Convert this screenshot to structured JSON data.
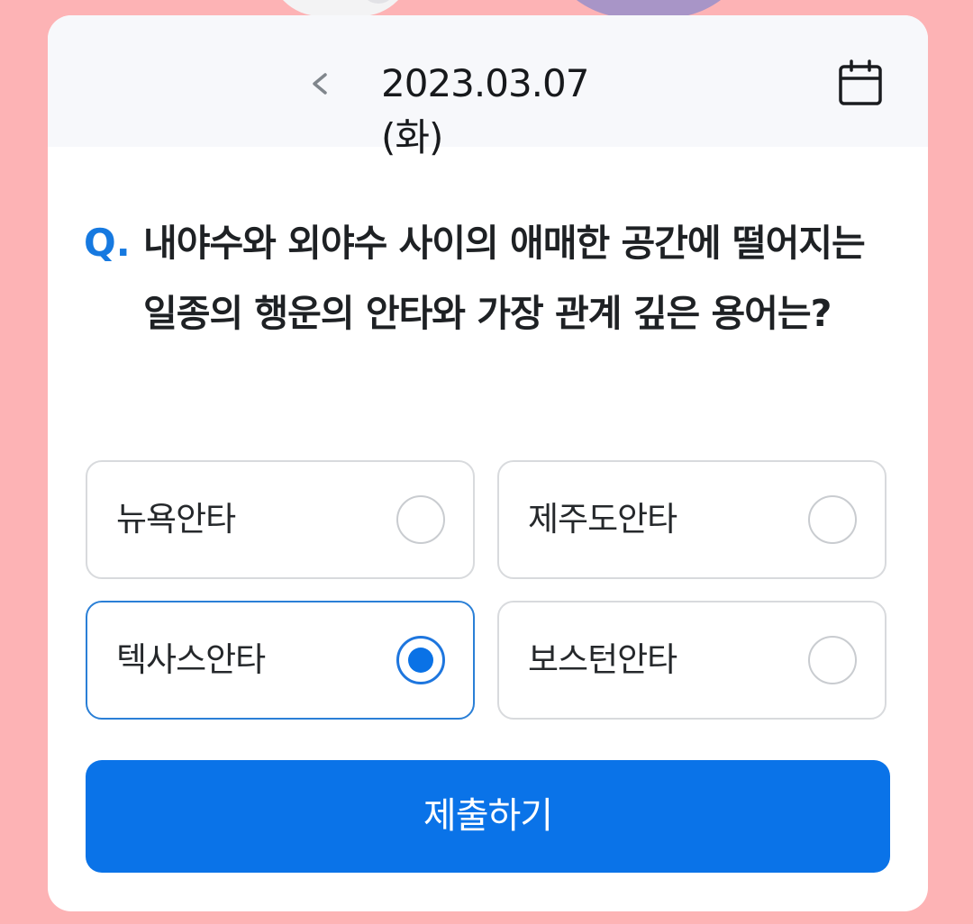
{
  "header": {
    "date": "2023.03.07 (화)",
    "prev_icon": "chevron-left-icon",
    "calendar_icon": "calendar-icon"
  },
  "question": {
    "prefix": "Q.",
    "text": "내야수와 외야수 사이의 애매한 공간에 떨어지는 일종의 행운의 안타와 가장 관계 깊은 용어는?"
  },
  "options": [
    {
      "label": "뉴욕안타",
      "selected": false
    },
    {
      "label": "제주도안타",
      "selected": false
    },
    {
      "label": "텍사스안타",
      "selected": true
    },
    {
      "label": "보스턴안타",
      "selected": false
    }
  ],
  "submit": {
    "label": "제출하기"
  },
  "colors": {
    "background": "#fdb3b5",
    "accent": "#0a73e8",
    "question_mark": "#1679e0",
    "header_bg": "#f7f8fb"
  }
}
